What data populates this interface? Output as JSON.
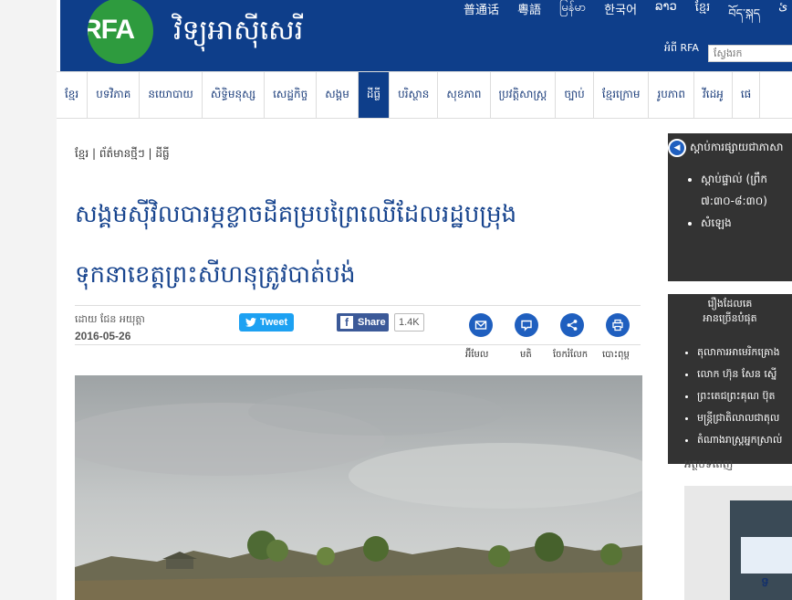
{
  "header": {
    "logo_text": "RFA",
    "site_name": "វិទ្យុអាស៊ីសេរី",
    "languages": [
      "普通话",
      "粵語",
      "မြန်မာ",
      "한국어",
      "ລາວ",
      "ខ្មែរ",
      "བོད་སྐད",
      "ئ"
    ],
    "about_label": "អំពី RFA",
    "search_placeholder": "ស្វែងរក",
    "colors": {
      "brand_blue": "#0e3e8a",
      "logo_green": "#2e9b3e"
    }
  },
  "nav": {
    "items": [
      "ខ្មែរ",
      "បទវិភាគ",
      "នយោបាយ",
      "សិទ្ធិមនុស្ស",
      "សេដ្ឋកិច្ច",
      "សង្គម",
      "ដីធ្លី",
      "បរិស្ថាន",
      "សុខភាព",
      "ប្រវត្តិសាស្ត្រ",
      "ច្បាប់",
      "ខ្មែរក្រោម",
      "រូបភាព",
      "វីដេអូ",
      "ផេ"
    ],
    "active_index": 6
  },
  "article": {
    "breadcrumb": "ខ្មែរ | ព័ត៌មានថ្មីៗ | ដីធ្លី",
    "title_line1": "សង្គមស៊ីវិលបារម្ភខ្លាចដីគម្របព្រៃឈើដែលរដ្ឋបម្រុង",
    "title_line2": "ទុកនាខេត្តព្រះសីហនុត្រូវបាត់បង់",
    "byline": "ដោយ ជែន អយុត្តា",
    "date": "2016-05-26",
    "tweet_label": "Tweet",
    "share_label": "Share",
    "share_count": "1.4K",
    "actions": [
      {
        "icon": "envelope-icon",
        "label": "អ៊ីមែល"
      },
      {
        "icon": "comment-icon",
        "label": "មតិ"
      },
      {
        "icon": "share-icon",
        "label": "ចែករំលែក"
      },
      {
        "icon": "print-icon",
        "label": "បោះពុម្ព"
      }
    ]
  },
  "sidebar": {
    "listen_heading": "ស្តាប់ការផ្សាយជាភាសា",
    "listen_items": [
      "ស្តាប់ផ្ទាល់ (ព្រឹក",
      "៧:៣០-៨:៣០)",
      "សំឡេង"
    ],
    "popular_title_line1": "រឿងដែលគេ",
    "popular_title_line2": "អានច្រើនបំផុត",
    "popular_items": [
      "តុលាការអាមេរិកគ្រោង",
      "លោក ហ៊ុន សែន ស្នើ",
      "ព្រះតេជព្រះគុណ ប៊ុត",
      "មន្ត្រីជ្រាតិលាលជាតុល",
      "តំណាងរាស្ត្រអ្នកស្រាល់"
    ],
    "section_title": "អត្ថបទពេញ",
    "photo_glyph": "ទ"
  }
}
